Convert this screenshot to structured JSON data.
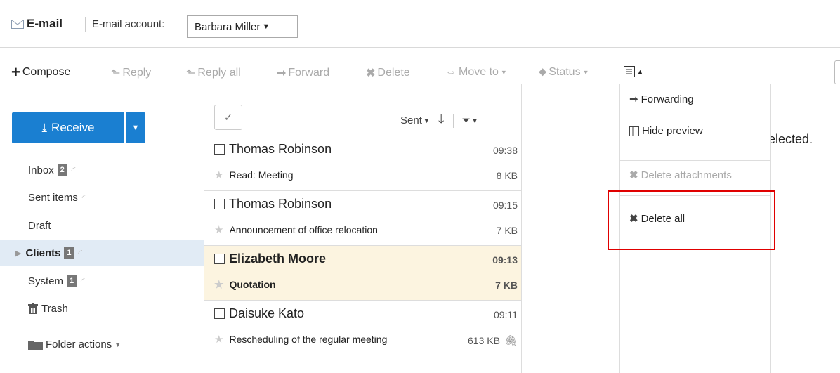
{
  "header": {
    "app_title": "E-mail",
    "account_label": "E-mail account:",
    "account_value": "Barbara Miller"
  },
  "toolbar": {
    "compose": "Compose",
    "reply": "Reply",
    "reply_all": "Reply all",
    "forward": "Forward",
    "delete": "Delete",
    "move_to": "Move to",
    "status": "Status"
  },
  "sidebar": {
    "receive": "Receive",
    "folders": [
      {
        "label": "Inbox",
        "badge": "2"
      },
      {
        "label": "Sent items"
      },
      {
        "label": "Draft"
      },
      {
        "label": "Clients",
        "badge": "1"
      },
      {
        "label": "System",
        "badge": "1"
      },
      {
        "label": "Trash"
      }
    ],
    "folder_actions": "Folder actions"
  },
  "list": {
    "sort_label": "Sent",
    "messages": [
      {
        "sender": "Thomas Robinson",
        "time": "09:38",
        "subject": "Read: Meeting",
        "size": "8 KB"
      },
      {
        "sender": "Thomas Robinson",
        "time": "09:15",
        "subject": "Announcement of office relocation",
        "size": "7 KB"
      },
      {
        "sender": "Elizabeth Moore",
        "time": "09:13",
        "subject": "Quotation",
        "size": "7 KB"
      },
      {
        "sender": "Daisuke Kato",
        "time": "09:11",
        "subject": "Rescheduling of the regular meeting",
        "size": "613 KB"
      }
    ]
  },
  "menu": {
    "forwarding": "Forwarding",
    "hide_preview": "Hide preview",
    "delete_attachments": "Delete attachments",
    "delete_all": "Delete all"
  },
  "preview": {
    "partial_text": "elected."
  },
  "colors": {
    "accent": "#1a7fd1",
    "unread_row": "#fcf4e0",
    "selected_folder": "#e1ebf5",
    "highlight": "#e00000"
  }
}
